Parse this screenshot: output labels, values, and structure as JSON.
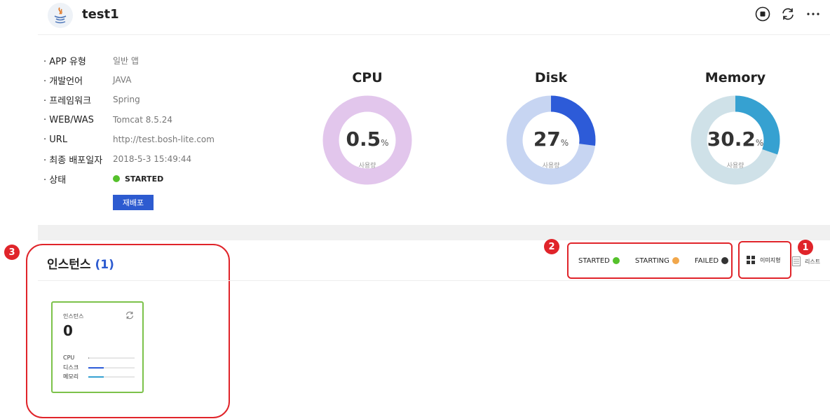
{
  "header": {
    "app_name": "test1",
    "icons": [
      "stop-icon",
      "refresh-icon",
      "more-icon"
    ]
  },
  "info": [
    {
      "label": "· APP 유형",
      "value": "일반 앱"
    },
    {
      "label": "· 개발언어",
      "value": "JAVA"
    },
    {
      "label": "· 프레임워크",
      "value": "Spring"
    },
    {
      "label": "· WEB/WAS",
      "value": "Tomcat 8.5.24"
    },
    {
      "label": "· URL",
      "value": "http://test.bosh-lite.com"
    },
    {
      "label": "· 최종 배포일자",
      "value": "2018-5-3 15:49:44"
    },
    {
      "label": "· 상태",
      "value": "STARTED"
    }
  ],
  "redeploy_label": "재배포",
  "gauges": [
    {
      "title": "CPU",
      "value": "0.5",
      "unit": "%",
      "sub": "사용량",
      "fraction": 0.005,
      "color": "#e2c6ec",
      "track": "#e2c6ec"
    },
    {
      "title": "Disk",
      "value": "27",
      "unit": "%",
      "sub": "사용량",
      "fraction": 0.27,
      "color": "#2d5bd8",
      "track": "#c7d5f2"
    },
    {
      "title": "Memory",
      "value": "30.2",
      "unit": "%",
      "sub": "사용량",
      "fraction": 0.302,
      "color": "#36a1d1",
      "track": "#cfe1e8"
    }
  ],
  "instances": {
    "title": "인스턴스",
    "count": "(1)"
  },
  "legend": [
    {
      "label": "STARTED",
      "color": "#55c12b"
    },
    {
      "label": "STARTING",
      "color": "#f1a74b"
    },
    {
      "label": "FAILED",
      "color": "#333333"
    }
  ],
  "view_modes": {
    "image": "이미지형",
    "list": "리스트"
  },
  "badges": [
    "1",
    "2",
    "3"
  ],
  "card": {
    "label": "인스턴스",
    "number": "0",
    "metrics": [
      {
        "label": "CPU",
        "fraction": 0.005,
        "color": "#999999"
      },
      {
        "label": "디스크",
        "fraction": 0.33,
        "color": "#2d5bd8"
      },
      {
        "label": "메모리",
        "fraction": 0.33,
        "color": "#36a1d1"
      }
    ]
  },
  "colors": {
    "accent": "#2d5bd0",
    "annotation": "#e0242a",
    "card_border": "#7cc24a"
  }
}
